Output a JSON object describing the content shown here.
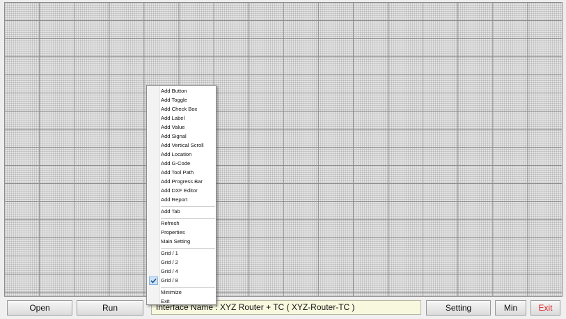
{
  "menu": {
    "items": [
      {
        "label": "Add Button"
      },
      {
        "label": "Add Toggle"
      },
      {
        "label": "Add Check Box"
      },
      {
        "label": "Add Label"
      },
      {
        "label": "Add Value"
      },
      {
        "label": "Add Signal"
      },
      {
        "label": "Add Vertical Scroll"
      },
      {
        "label": "Add Location"
      },
      {
        "label": "Add G-Code"
      },
      {
        "label": "Add Tool Path"
      },
      {
        "label": "Add Progress Bar"
      },
      {
        "label": "Add DXF Editor"
      },
      {
        "label": "Add Report"
      },
      {
        "label": "Add Tab"
      },
      {
        "label": "Refresh"
      },
      {
        "label": "Properties"
      },
      {
        "label": "Main Setting"
      },
      {
        "label": "Grid / 1"
      },
      {
        "label": "Grid / 2"
      },
      {
        "label": "Grid / 4"
      },
      {
        "label": "Grid / 8",
        "checked": true
      },
      {
        "label": "Minimize"
      },
      {
        "label": "Exit"
      }
    ],
    "check_icon": "checkmark-icon"
  },
  "toolbar": {
    "open_label": "Open",
    "run_label": "Run",
    "setting_label": "Setting",
    "min_label": "Min",
    "exit_label": "Exit"
  },
  "status": {
    "interface_text": "Interface Name : XYZ Router + TC ( XYZ-Router-TC )"
  },
  "colors": {
    "exit_text": "#e02020",
    "status_bg": "#f8f8df",
    "check_bg": "#cfe3f7"
  }
}
